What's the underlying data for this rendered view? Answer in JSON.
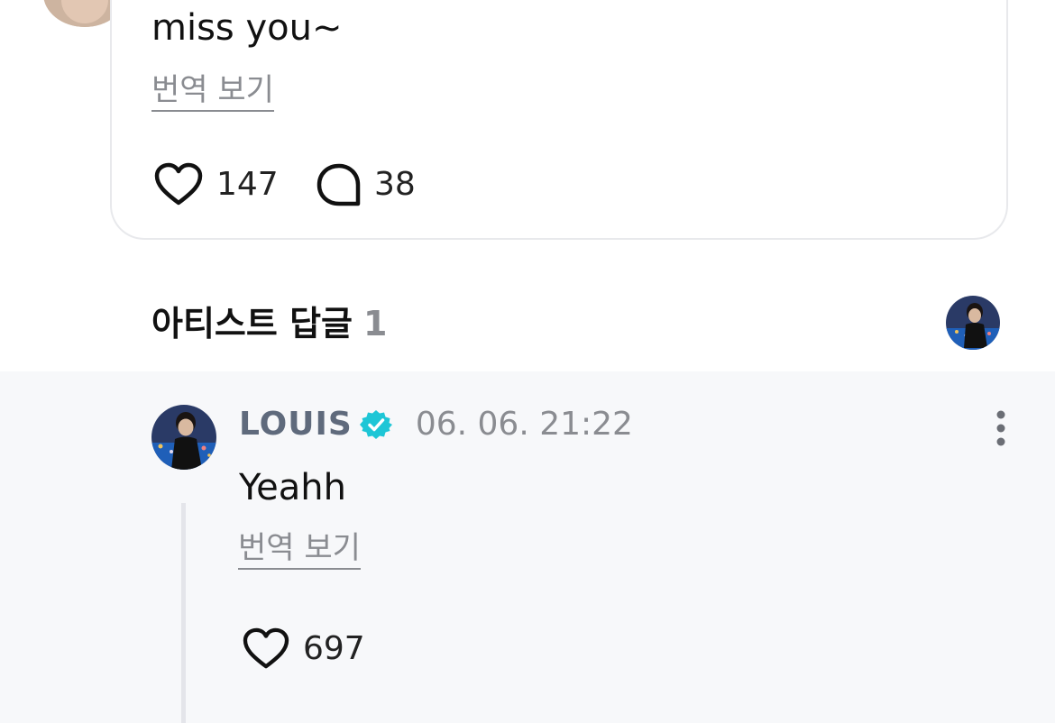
{
  "post": {
    "text": "miss you~",
    "translate_label": "번역 보기",
    "like_count": "147",
    "comment_count": "38"
  },
  "artist_replies": {
    "title": "아티스트 답글",
    "count": "1"
  },
  "reply": {
    "author": "LOUIS",
    "timestamp": "06. 06. 21:22",
    "text": "Yeahh",
    "translate_label": "번역 보기",
    "like_count": "697"
  },
  "icons": {
    "like": "heart-outline-icon",
    "comment": "speech-bubble-icon",
    "verified": "verified-badge-icon",
    "more": "more-vertical-icon"
  },
  "colors": {
    "verified_badge": "#1ec6d6",
    "author_name": "#5f6a7c",
    "muted_text": "#8a8c91",
    "reply_background": "#f7f8fa"
  }
}
